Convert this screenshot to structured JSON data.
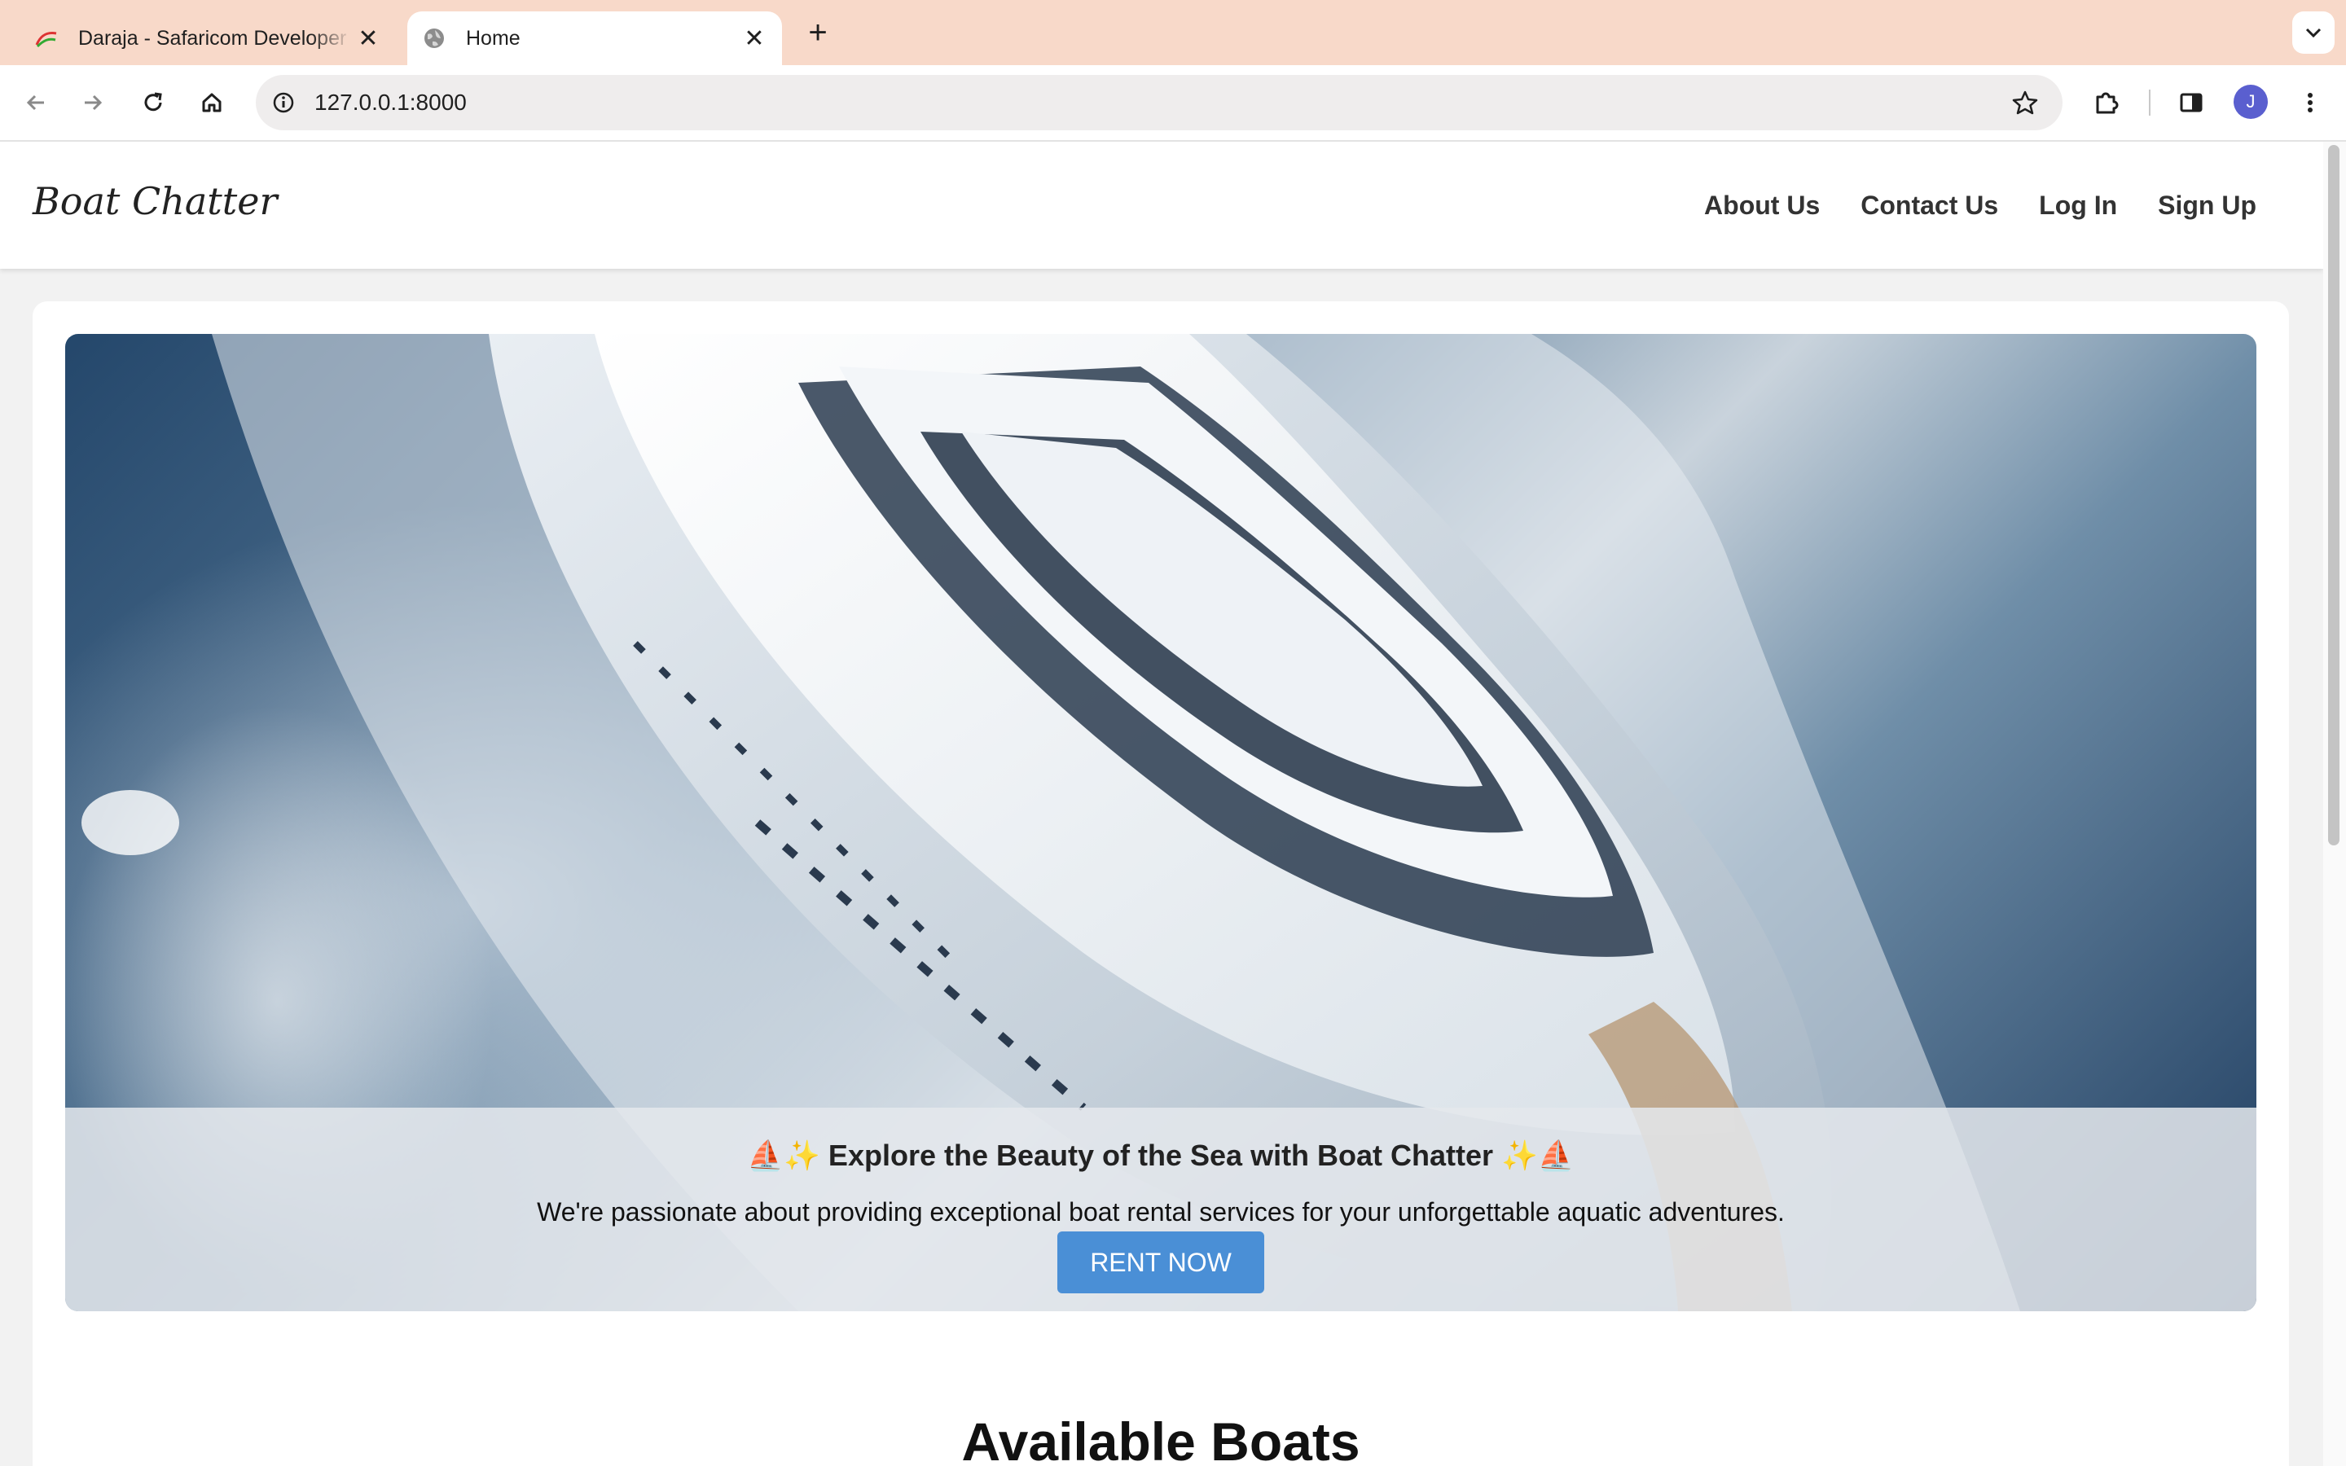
{
  "browser": {
    "tabs": [
      {
        "title": "Daraja - Safaricom Developer",
        "active": false
      },
      {
        "title": "Home",
        "active": true
      }
    ],
    "url": "127.0.0.1:8000",
    "profile_initial": "J"
  },
  "nav": {
    "brand": "Boat Chatter",
    "links": [
      "About Us",
      "Contact Us",
      "Log In",
      "Sign Up"
    ]
  },
  "hero": {
    "headline": "⛵✨ Explore the Beauty of the Sea with Boat Chatter ✨⛵",
    "subtext": "We're passionate about providing exceptional boat rental services for your unforgettable aquatic adventures.",
    "cta_label": "RENT NOW"
  },
  "sections": {
    "available_title": "Available Boats"
  },
  "colors": {
    "tab_strip": "#f8d9c9",
    "cta": "#4a8fd6",
    "page_bg": "#f2f2f2"
  }
}
